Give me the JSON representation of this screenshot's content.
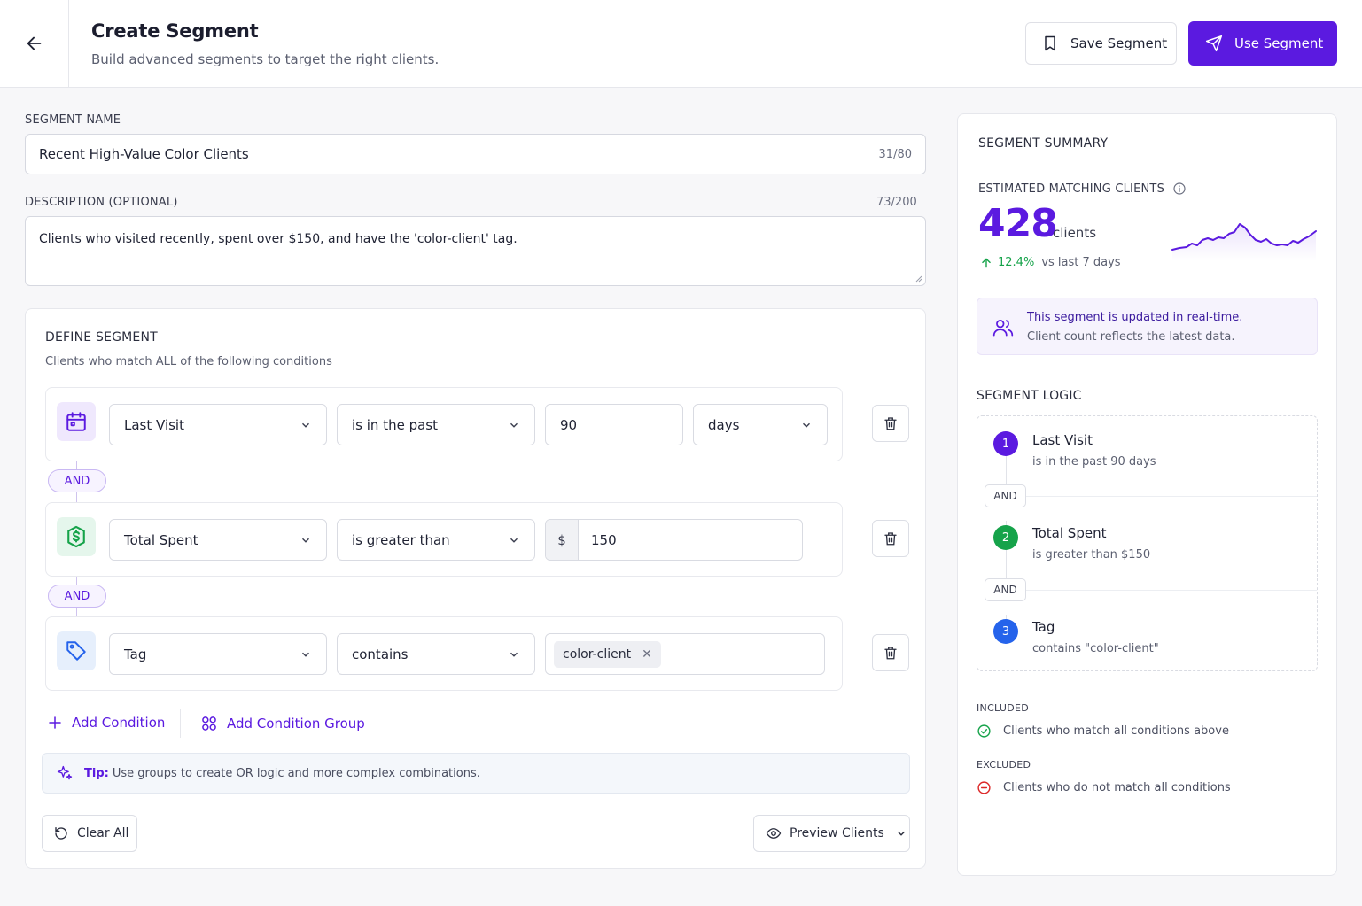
{
  "header": {
    "title": "Create Segment",
    "subtitle": "Build advanced segments to target the right clients.",
    "save_label": "Save Segment",
    "use_label": "Use Segment"
  },
  "form": {
    "name_label": "SEGMENT NAME",
    "name_value": "Recent High-Value Color Clients",
    "name_count": "31/80",
    "desc_label": "DESCRIPTION (OPTIONAL)",
    "desc_count": "73/200",
    "desc_value": "Clients who visited recently, spent over $150, and have the 'color-client' tag."
  },
  "define": {
    "title": "DEFINE SEGMENT",
    "subtitle": "Clients who match ALL of the following conditions",
    "connector": "AND",
    "conditions": [
      {
        "field": "Last Visit",
        "operator": "is in the past",
        "value": "90",
        "unit": "days",
        "icon": "calendar-icon"
      },
      {
        "field": "Total Spent",
        "operator": "is greater than",
        "prefix": "$",
        "value": "150",
        "icon": "dollar-icon"
      },
      {
        "field": "Tag",
        "operator": "contains",
        "tag": "color-client",
        "icon": "tag-icon"
      }
    ],
    "add_condition": "Add Condition",
    "add_group": "Add Condition Group",
    "tip_label": "Tip:",
    "tip_text": "Use groups to create OR logic and more complex combinations.",
    "clear_all": "Clear All",
    "preview": "Preview Clients"
  },
  "summary": {
    "title": "SEGMENT SUMMARY",
    "est_label": "ESTIMATED MATCHING CLIENTS",
    "count": "428",
    "count_unit": "clients",
    "change": "12.4%",
    "change_suffix": "vs last 7 days",
    "realtime_title": "This segment is updated in real-time.",
    "realtime_sub": "Client count reflects the latest data.",
    "logic_title": "SEGMENT LOGIC",
    "logic_connector": "AND",
    "steps": [
      {
        "num": "1",
        "title": "Last Visit",
        "desc": "is in the past 90 days",
        "color": "#5b1ae0"
      },
      {
        "num": "2",
        "title": "Total Spent",
        "desc": "is greater than $150",
        "color": "#16a34a"
      },
      {
        "num": "3",
        "title": "Tag",
        "desc": "contains \"color-client\"",
        "color": "#2563eb"
      }
    ],
    "included_label": "INCLUDED",
    "included_text": "Clients who match all conditions above",
    "excluded_label": "EXCLUDED",
    "excluded_text": "Clients who do not match all conditions"
  },
  "colors": {
    "accent": "#5b1ae0",
    "positive": "#16a34a",
    "negative": "#dc2626",
    "info": "#2563eb"
  }
}
